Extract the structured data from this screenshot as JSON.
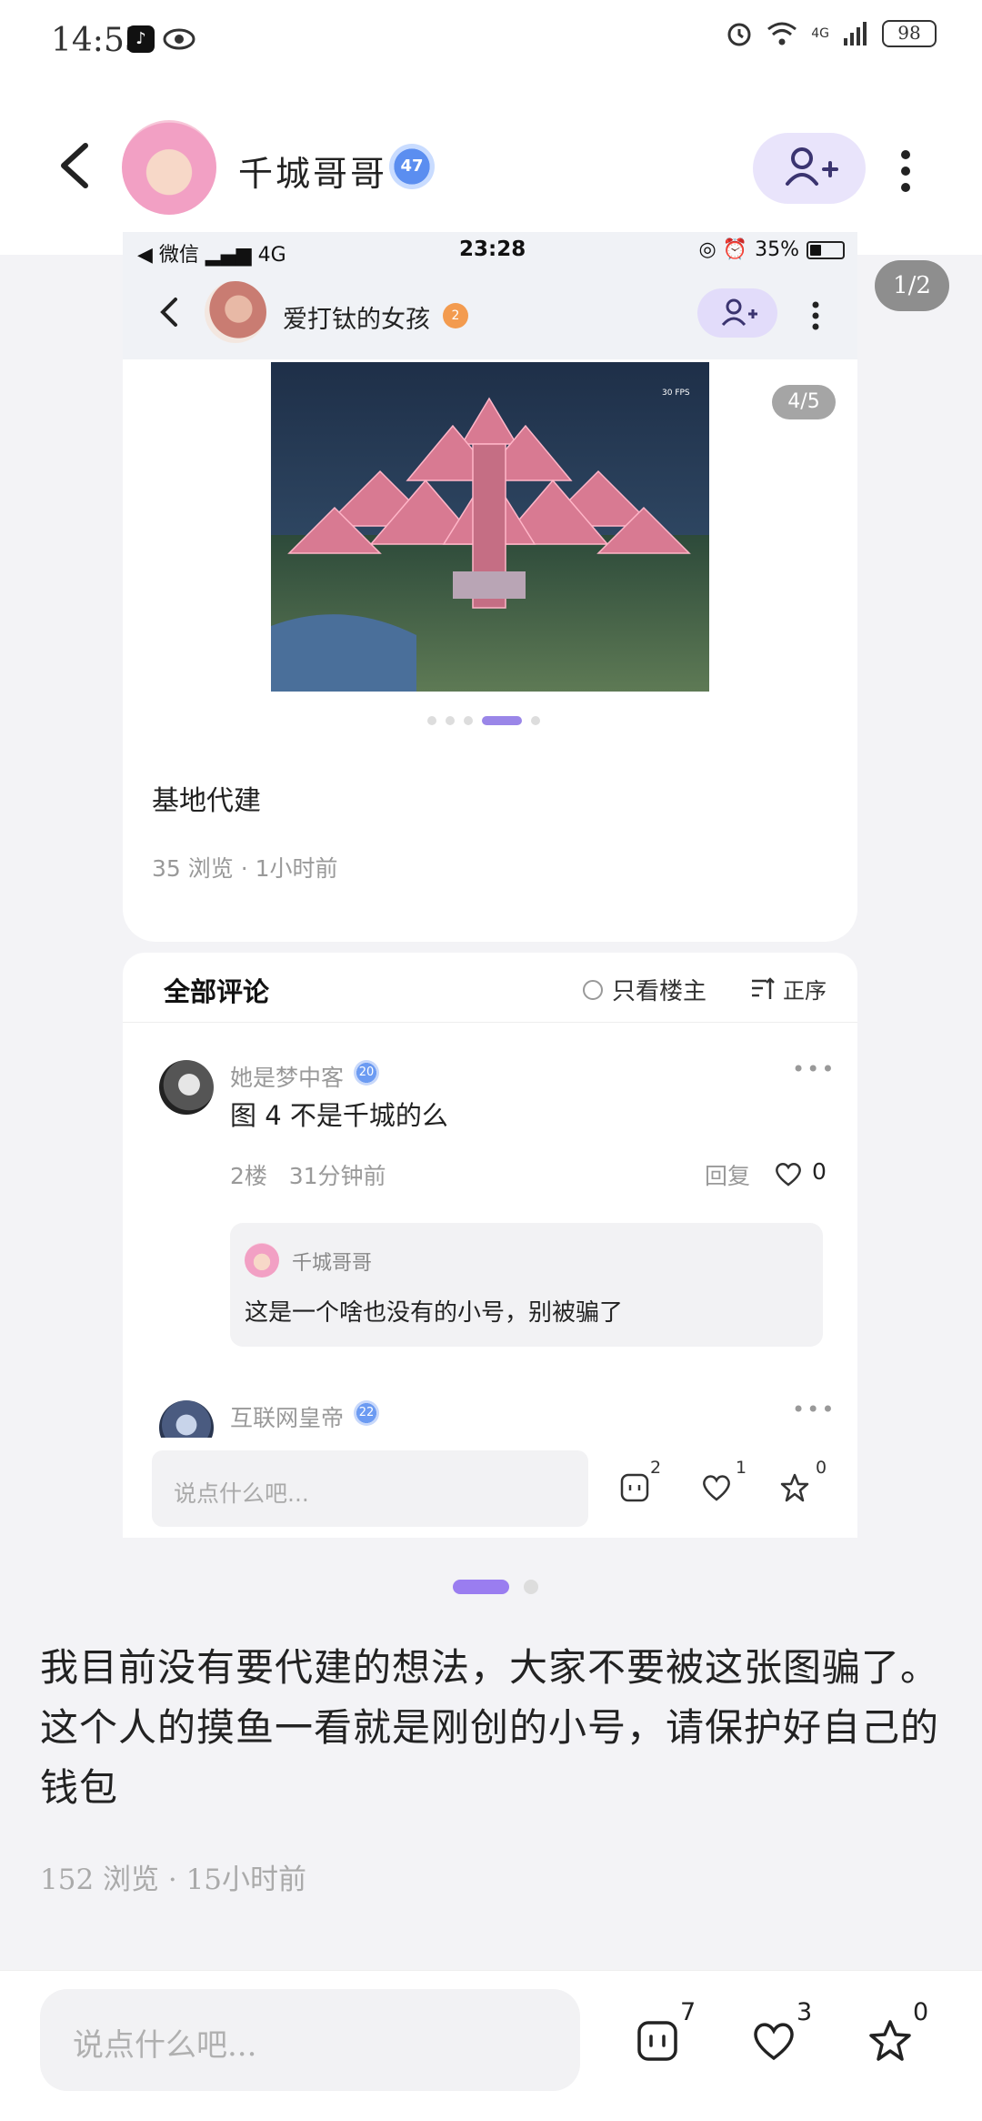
{
  "status_bar": {
    "time": "14:53",
    "battery": "98",
    "network": "4G"
  },
  "header": {
    "username": "千城哥哥",
    "level": "47"
  },
  "page_indicator": "1/2",
  "screenshot": {
    "inner_status": {
      "carrier": "◀ 微信",
      "network": "4G",
      "time": "23:28",
      "battery": "35%"
    },
    "inner_header": {
      "username": "爱打钛的女孩",
      "badge": "2"
    },
    "image_counter": "4/5",
    "fps_label": "30 FPS",
    "post_text": "基地代建",
    "post_meta": "35 浏览 · 1小时前",
    "comments": {
      "title": "全部评论",
      "only_op": "只看楼主",
      "sort": "正序",
      "items": [
        {
          "name": "她是梦中客",
          "badge": "20",
          "text": "图 4 不是千城的么",
          "meta": "2楼   31分钟前",
          "reply_label": "回复",
          "likes": "0",
          "reply": {
            "name": "千城哥哥",
            "text": "这是一个啥也没有的小号，别被骗了"
          }
        },
        {
          "name": "互联网皇帝",
          "badge": "22"
        }
      ]
    },
    "bottom": {
      "placeholder": "说点什么吧...",
      "comments": "2",
      "likes": "1",
      "stars": "0"
    }
  },
  "main": {
    "text": "我目前没有要代建的想法，大家不要被这张图骗了。这个人的摸鱼一看就是刚创的小号，请保护好自己的钱包",
    "meta": "152 浏览 · 15小时前"
  },
  "bottom_bar": {
    "placeholder": "说点什么吧...",
    "comments": "7",
    "likes": "3",
    "stars": "0"
  },
  "colors": {
    "accent": "#9a7df0",
    "follow_bg": "#e9e4fb"
  }
}
